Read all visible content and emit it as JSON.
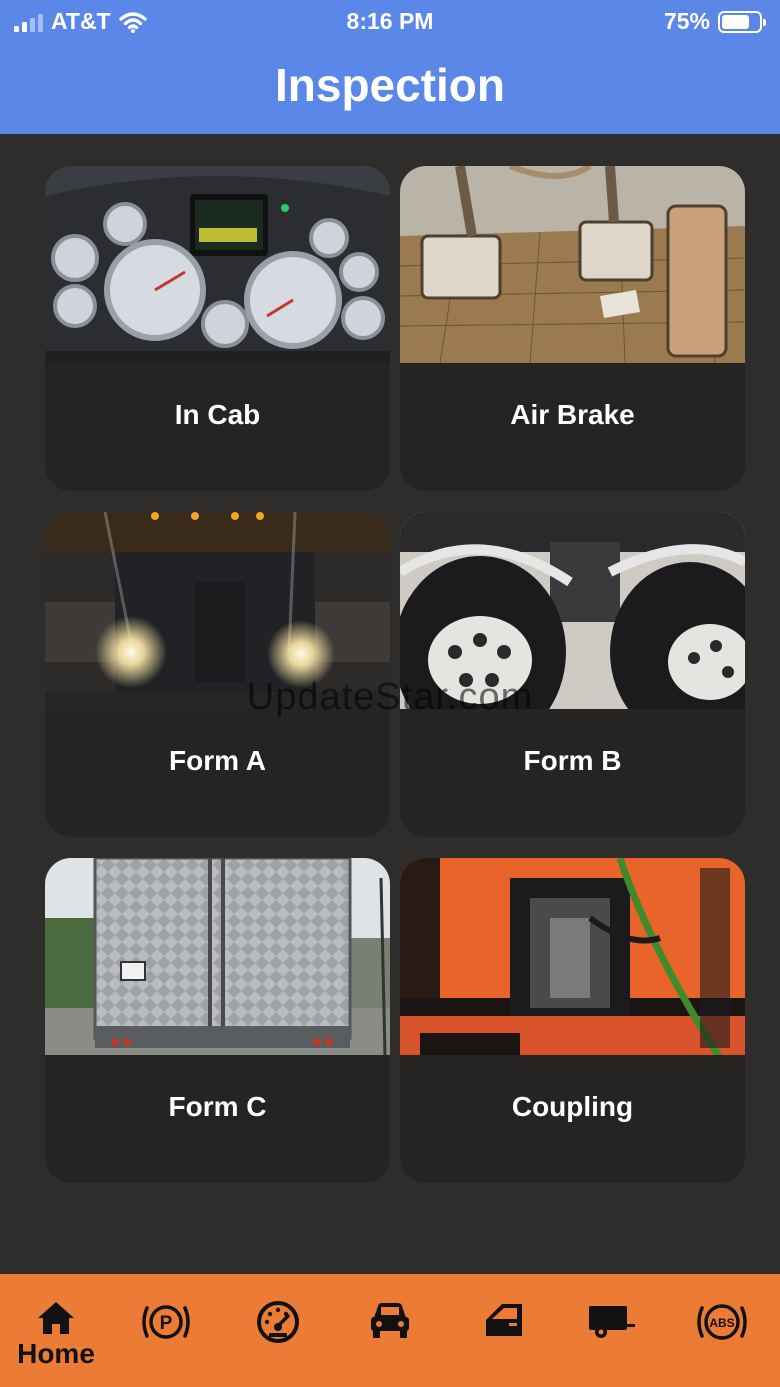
{
  "status_bar": {
    "carrier": "AT&T",
    "time": "8:16 PM",
    "battery_percent": "75%",
    "battery_level": 0.75,
    "signal_icon": "signal-bars-icon",
    "wifi_icon": "wifi-icon",
    "battery_icon": "battery-icon"
  },
  "header": {
    "title": "Inspection"
  },
  "cards": [
    {
      "label": "In Cab",
      "image": "dashboard-gauges-photo"
    },
    {
      "label": "Air Brake",
      "image": "brake-pedals-photo"
    },
    {
      "label": "Form A",
      "image": "truck-headlights-photo"
    },
    {
      "label": "Form B",
      "image": "truck-wheels-photo"
    },
    {
      "label": "Form C",
      "image": "trailer-rear-photo"
    },
    {
      "label": "Coupling",
      "image": "coupling-lines-photo"
    }
  ],
  "watermark": "UpdateStar.com",
  "tabs": [
    {
      "label": "Home",
      "icon": "home-icon",
      "active": true
    },
    {
      "label": "",
      "icon": "parking-brake-icon"
    },
    {
      "label": "",
      "icon": "speedometer-icon"
    },
    {
      "label": "",
      "icon": "car-icon"
    },
    {
      "label": "",
      "icon": "car-door-icon"
    },
    {
      "label": "",
      "icon": "trailer-icon"
    },
    {
      "label": "",
      "icon": "abs-icon"
    }
  ],
  "colors": {
    "header_blue": "#5b87e8",
    "background": "#2f2d2c",
    "card": "#252423",
    "tab_bar_orange": "#ec7c35"
  }
}
